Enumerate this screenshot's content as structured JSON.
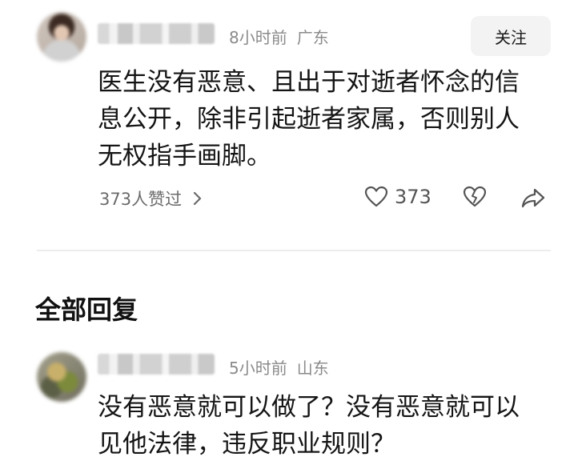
{
  "comment": {
    "time": "8小时前",
    "location": "广东",
    "follow_label": "关注",
    "text_lines": [
      "医生没有恶意、且出于对逝者怀念的信",
      "息公开，除非引起逝者家属，否则别人",
      "无权指手画脚。"
    ],
    "likes_summary": "373人赞过",
    "like_count": "373",
    "icons": {
      "like": "heart-icon",
      "dislike": "broken-heart-icon",
      "share": "share-icon",
      "more": "chevron-right-icon"
    }
  },
  "section": {
    "title": "全部回复"
  },
  "reply": {
    "time": "5小时前",
    "location": "山东",
    "text_lines": [
      "没有恶意就可以做了？没有恶意就可以",
      "见他法律，违反职业规则？"
    ]
  }
}
